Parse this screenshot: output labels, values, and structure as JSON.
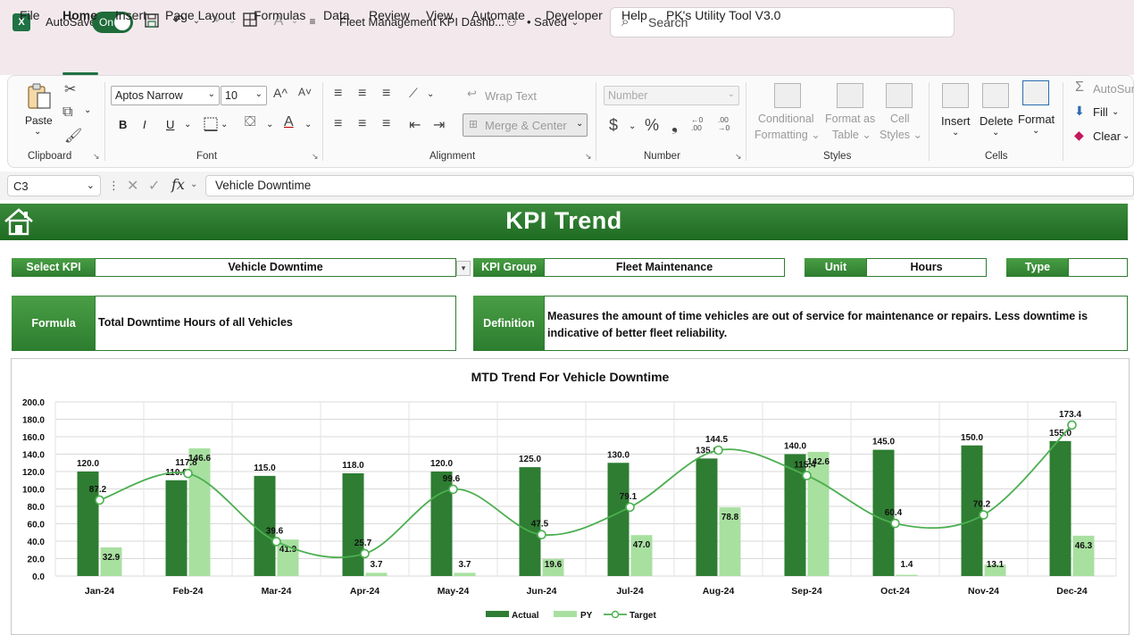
{
  "titlebar": {
    "app_icon": "X",
    "autosave_label": "AutoSave",
    "autosave_state": "On",
    "doc_title": "Fleet Management KPI Dashb...",
    "saved_status": "• Saved",
    "search_placeholder": "Search"
  },
  "menu": {
    "items": [
      "File",
      "Home",
      "Insert",
      "Page Layout",
      "Formulas",
      "Data",
      "Review",
      "View",
      "Automate",
      "Developer",
      "Help",
      "PK's Utility Tool V3.0"
    ],
    "active": "Home"
  },
  "ribbon": {
    "clipboard": {
      "paste": "Paste",
      "label": "Clipboard"
    },
    "font": {
      "name": "Aptos Narrow",
      "size": "10",
      "bold": "B",
      "italic": "I",
      "underline": "U",
      "label": "Font"
    },
    "alignment": {
      "wrap": "Wrap Text",
      "merge": "Merge & Center",
      "label": "Alignment"
    },
    "number": {
      "format": "Number",
      "currency": "$",
      "percent": "%",
      "comma": "❟",
      "inc_dec": "←0 .00",
      "dec_dec": ".00 →0",
      "label": "Number"
    },
    "styles": {
      "conditional": [
        "Conditional",
        "Formatting ⌄"
      ],
      "format_table": [
        "Format as",
        "Table ⌄"
      ],
      "cell_styles": [
        "Cell",
        "Styles ⌄"
      ],
      "label": "Styles"
    },
    "cells": {
      "insert": "Insert",
      "delete": "Delete",
      "format": "Format",
      "label": "Cells"
    },
    "editing": {
      "autosum": "AutoSur",
      "fill": "Fill",
      "clear": "Clear"
    }
  },
  "formula_bar": {
    "cell_ref": "C3",
    "fx": "fx",
    "value": "Vehicle Downtime"
  },
  "dashboard": {
    "title": "KPI Trend",
    "select_kpi_label": "Select KPI",
    "select_kpi_value": "Vehicle Downtime",
    "kpi_group_label": "KPI Group",
    "kpi_group_value": "Fleet Maintenance",
    "unit_label": "Unit",
    "unit_value": "Hours",
    "type_label": "Type",
    "type_value": "",
    "formula_label": "Formula",
    "formula_value": "Total Downtime Hours of all Vehicles",
    "definition_label": "Definition",
    "definition_line1": "Measures the amount of time vehicles are out of service for maintenance or repairs. Less downtime is",
    "definition_line2": "indicative of better fleet reliability."
  },
  "colors": {
    "actual": "#2e7d32",
    "py": "#a8e0a0",
    "target": "#4caf50",
    "banner": "#1e6b22"
  },
  "chart_data": {
    "type": "bar",
    "title": "MTD Trend For Vehicle Downtime",
    "categories": [
      "Jan-24",
      "Feb-24",
      "Mar-24",
      "Apr-24",
      "May-24",
      "Jun-24",
      "Jul-24",
      "Aug-24",
      "Sep-24",
      "Oct-24",
      "Nov-24",
      "Dec-24"
    ],
    "ylim": [
      0,
      200
    ],
    "yticks": [
      "0.0",
      "20.0",
      "40.0",
      "60.0",
      "80.0",
      "100.0",
      "120.0",
      "140.0",
      "160.0",
      "180.0",
      "200.0"
    ],
    "grid": true,
    "legend_position": "bottom",
    "series": [
      {
        "name": "Actual",
        "kind": "bar",
        "values": [
          120.0,
          110.0,
          115.0,
          118.0,
          120.0,
          125.0,
          130.0,
          135.0,
          140.0,
          145.0,
          150.0,
          155.0
        ]
      },
      {
        "name": "PY",
        "kind": "bar",
        "values": [
          32.9,
          146.6,
          41.9,
          3.7,
          3.7,
          19.6,
          47.0,
          78.8,
          142.6,
          1.4,
          13.1,
          46.3
        ]
      },
      {
        "name": "Target",
        "kind": "line",
        "values": [
          87.2,
          117.8,
          39.6,
          25.7,
          99.6,
          47.5,
          79.1,
          144.5,
          115.4,
          60.4,
          70.2,
          173.4
        ]
      }
    ]
  }
}
